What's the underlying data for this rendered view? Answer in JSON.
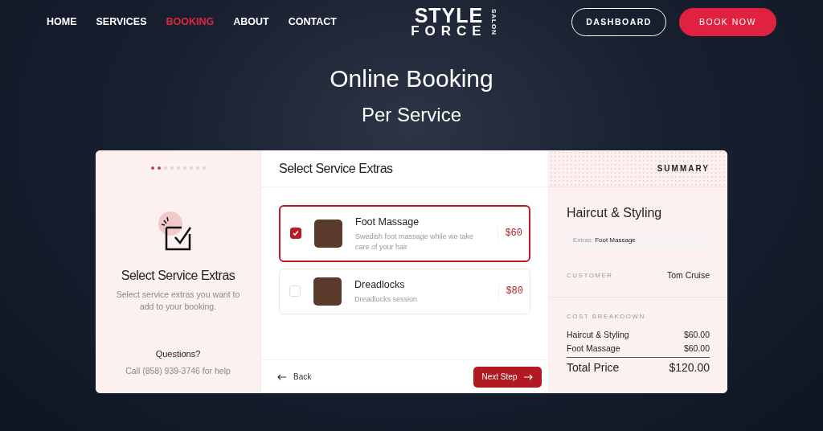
{
  "nav": {
    "links": [
      {
        "label": "HOME",
        "selected": false
      },
      {
        "label": "SERVICES",
        "selected": false
      },
      {
        "label": "BOOKING",
        "selected": true
      },
      {
        "label": "ABOUT",
        "selected": false
      },
      {
        "label": "CONTACT",
        "selected": false
      }
    ],
    "logo": {
      "line_1": "STYLE",
      "line_2": "FORCE",
      "side": "SALON"
    },
    "buttons": [
      {
        "label": "DASHBOARD",
        "kind": "outline"
      },
      {
        "label": "BOOK NOW",
        "kind": "filled"
      }
    ]
  },
  "hero": {
    "title": "Online Booking",
    "subtitle": "Per Service"
  },
  "steps": [
    {
      "done": true
    },
    {
      "done": true
    },
    {
      "done": false
    },
    {
      "done": false
    },
    {
      "done": false
    },
    {
      "done": false
    },
    {
      "done": false
    },
    {
      "done": false
    },
    {
      "done": false
    }
  ],
  "side_panel": {
    "title": "Select Service Extras",
    "description": "Select service extras you want to add to your booking.",
    "help_title": "Questions?",
    "help_text": "Call (858) 939-3746 for help"
  },
  "main": {
    "title": "Select Service Extras",
    "extras": [
      {
        "name": "Foot Massage",
        "description": "Swedish foot massage while we take care of your hair",
        "price": "$60",
        "checked": true
      },
      {
        "name": "Dreadlocks",
        "description": "Dreadlocks session",
        "price": "$80",
        "checked": false
      }
    ],
    "back": "Back",
    "next": "Next Step"
  },
  "summary": {
    "heading": "SUMMARY",
    "service": "Haircut & Styling",
    "extras_label": "Extras:",
    "extras_value": "Foot Massage",
    "customer_label": "CUSTOMER",
    "customer": "Tom Cruise",
    "breakdown_label": "COST BREAKDOWN",
    "lines": [
      {
        "label": "Haircut & Styling",
        "amount": "$60.00"
      },
      {
        "label": "Foot Massage",
        "amount": "$60.00"
      }
    ],
    "total_label": "Total Price",
    "total": "$120.00"
  }
}
